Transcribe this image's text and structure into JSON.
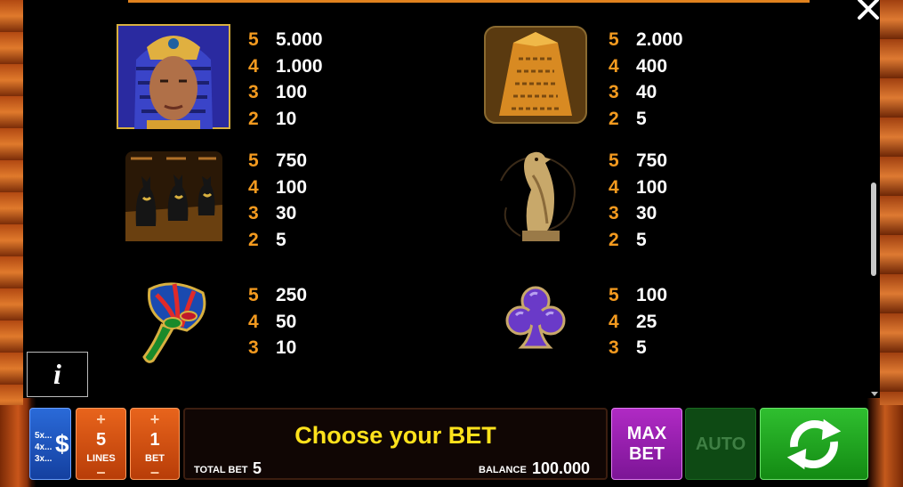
{
  "paytable": [
    {
      "symbol": "pharaoh-icon",
      "pays": [
        {
          "count": "5",
          "value": "5.000"
        },
        {
          "count": "4",
          "value": "1.000"
        },
        {
          "count": "3",
          "value": "100"
        },
        {
          "count": "2",
          "value": "10"
        }
      ]
    },
    {
      "symbol": "obelisk-icon",
      "pays": [
        {
          "count": "5",
          "value": "2.000"
        },
        {
          "count": "4",
          "value": "400"
        },
        {
          "count": "3",
          "value": "40"
        },
        {
          "count": "2",
          "value": "5"
        }
      ]
    },
    {
      "symbol": "cat-statues-icon",
      "pays": [
        {
          "count": "5",
          "value": "750"
        },
        {
          "count": "4",
          "value": "100"
        },
        {
          "count": "3",
          "value": "30"
        },
        {
          "count": "2",
          "value": "5"
        }
      ]
    },
    {
      "symbol": "falcon-statue-icon",
      "pays": [
        {
          "count": "5",
          "value": "750"
        },
        {
          "count": "4",
          "value": "100"
        },
        {
          "count": "3",
          "value": "30"
        },
        {
          "count": "2",
          "value": "5"
        }
      ]
    },
    {
      "symbol": "lotus-fan-icon",
      "pays": [
        {
          "count": "5",
          "value": "250"
        },
        {
          "count": "4",
          "value": "50"
        },
        {
          "count": "3",
          "value": "10"
        }
      ]
    },
    {
      "symbol": "club-icon",
      "pays": [
        {
          "count": "5",
          "value": "100"
        },
        {
          "count": "4",
          "value": "25"
        },
        {
          "count": "3",
          "value": "5"
        }
      ]
    }
  ],
  "info_label": "i",
  "controls": {
    "gamble_multipliers": [
      "5x...",
      "4x...",
      "3x..."
    ],
    "currency_symbol": "$",
    "plus": "+",
    "minus": "–",
    "lines_value": "5",
    "lines_label": "LINES",
    "bet_value": "1",
    "bet_label": "BET",
    "message": "Choose your BET",
    "total_bet_label": "TOTAL BET",
    "total_bet_value": "5",
    "balance_label": "BALANCE",
    "balance_value": "100.000",
    "max_bet_line1": "MAX",
    "max_bet_line2": "BET",
    "auto_label": "AUTO"
  },
  "colors": {
    "accent": "#f39a1f",
    "message": "#ffe21c",
    "spin": "#1fa81f",
    "max_bet": "#9a20b0",
    "stepper": "#d4521a"
  }
}
